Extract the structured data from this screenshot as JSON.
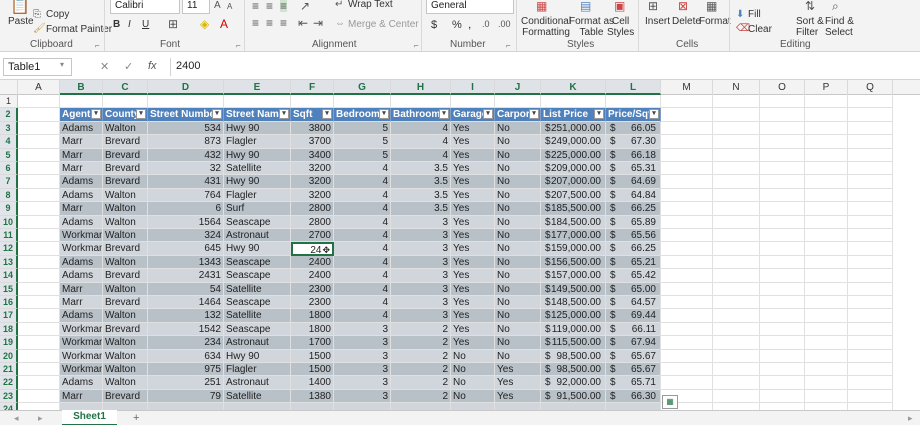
{
  "ribbon": {
    "paste": "Paste",
    "copy": "Copy",
    "format_painter": "Format Painter",
    "font_name": "Calibri",
    "font_size": "11",
    "bold": "B",
    "italic": "I",
    "underline": "U",
    "wrap_text": "Wrap Text",
    "merge_center": "Merge & Center",
    "number_format": "General",
    "currency": "$",
    "percent": "%",
    "comma": ",",
    "conditional_formatting": "Conditional\nFormatting",
    "format_as_table": "Format as\nTable",
    "cell_styles": "Cell\nStyles",
    "insert": "Insert",
    "delete": "Delete",
    "format": "Format",
    "fill": "Fill",
    "clear": "Clear",
    "sort_filter": "Sort &\nFilter",
    "find_select": "Find &\nSelect",
    "groups": {
      "clipboard": "Clipboard",
      "font": "Font",
      "alignment": "Alignment",
      "number": "Number",
      "styles": "Styles",
      "cells": "Cells",
      "editing": "Editing"
    }
  },
  "formula_bar": {
    "name_box": "Table1",
    "cancel": "✕",
    "enter": "✓",
    "fx": "fx",
    "value": "2400"
  },
  "sheet": {
    "columns": [
      "A",
      "B",
      "C",
      "D",
      "E",
      "F",
      "G",
      "H",
      "I",
      "J",
      "K",
      "L",
      "M",
      "N",
      "O",
      "P",
      "Q"
    ],
    "row_numbers": [
      "1",
      "2",
      "3",
      "4",
      "5",
      "6",
      "7",
      "8",
      "9",
      "10",
      "11",
      "12",
      "13",
      "14",
      "15",
      "16",
      "17",
      "18",
      "19",
      "20",
      "21",
      "22",
      "23",
      "24"
    ],
    "headers": [
      "Agent",
      "County",
      "Street Number",
      "Street Name",
      "Sqft",
      "Bedrooms",
      "Bathrooms",
      "Garage",
      "Carport",
      "List Price",
      "Price/Sqft"
    ],
    "rows": [
      [
        "Adams",
        "Walton",
        "534",
        "Hwy 90",
        "3800",
        "5",
        "4",
        "Yes",
        "No",
        "$",
        "251,000.00",
        "$",
        "66.05"
      ],
      [
        "Marr",
        "Brevard",
        "873",
        "Flagler",
        "3700",
        "5",
        "4",
        "Yes",
        "No",
        "$",
        "249,000.00",
        "$",
        "67.30"
      ],
      [
        "Marr",
        "Brevard",
        "432",
        "Hwy 90",
        "3400",
        "5",
        "4",
        "Yes",
        "No",
        "$",
        "225,000.00",
        "$",
        "66.18"
      ],
      [
        "Marr",
        "Brevard",
        "32",
        "Satellite",
        "3200",
        "4",
        "3.5",
        "Yes",
        "No",
        "$",
        "209,000.00",
        "$",
        "65.31"
      ],
      [
        "Adams",
        "Brevard",
        "431",
        "Hwy 90",
        "3200",
        "4",
        "3.5",
        "Yes",
        "No",
        "$",
        "207,000.00",
        "$",
        "64.69"
      ],
      [
        "Adams",
        "Walton",
        "764",
        "Flagler",
        "3200",
        "4",
        "3.5",
        "Yes",
        "No",
        "$",
        "207,500.00",
        "$",
        "64.84"
      ],
      [
        "Marr",
        "Walton",
        "6",
        "Surf",
        "2800",
        "4",
        "3.5",
        "Yes",
        "No",
        "$",
        "185,500.00",
        "$",
        "66.25"
      ],
      [
        "Adams",
        "Walton",
        "1564",
        "Seascape",
        "2800",
        "4",
        "3",
        "Yes",
        "No",
        "$",
        "184,500.00",
        "$",
        "65.89"
      ],
      [
        "Workman",
        "Walton",
        "324",
        "Astronaut",
        "2700",
        "4",
        "3",
        "Yes",
        "No",
        "$",
        "177,000.00",
        "$",
        "65.56"
      ],
      [
        "Workman",
        "Brevard",
        "645",
        "Hwy 90",
        "2400",
        "4",
        "3",
        "Yes",
        "No",
        "$",
        "159,000.00",
        "$",
        "66.25"
      ],
      [
        "Adams",
        "Walton",
        "1343",
        "Seascape",
        "2400",
        "4",
        "3",
        "Yes",
        "No",
        "$",
        "156,500.00",
        "$",
        "65.21"
      ],
      [
        "Adams",
        "Brevard",
        "2431",
        "Seascape",
        "2400",
        "4",
        "3",
        "Yes",
        "No",
        "$",
        "157,000.00",
        "$",
        "65.42"
      ],
      [
        "Marr",
        "Walton",
        "54",
        "Satellite",
        "2300",
        "4",
        "3",
        "Yes",
        "No",
        "$",
        "149,500.00",
        "$",
        "65.00"
      ],
      [
        "Marr",
        "Brevard",
        "1464",
        "Seascape",
        "2300",
        "4",
        "3",
        "Yes",
        "No",
        "$",
        "148,500.00",
        "$",
        "64.57"
      ],
      [
        "Adams",
        "Walton",
        "132",
        "Satellite",
        "1800",
        "4",
        "3",
        "Yes",
        "No",
        "$",
        "125,000.00",
        "$",
        "69.44"
      ],
      [
        "Workman",
        "Brevard",
        "1542",
        "Seascape",
        "1800",
        "3",
        "2",
        "Yes",
        "No",
        "$",
        "119,000.00",
        "$",
        "66.11"
      ],
      [
        "Workman",
        "Walton",
        "234",
        "Astronaut",
        "1700",
        "3",
        "2",
        "Yes",
        "No",
        "$",
        "115,500.00",
        "$",
        "67.94"
      ],
      [
        "Workman",
        "Walton",
        "634",
        "Hwy 90",
        "1500",
        "3",
        "2",
        "No",
        "No",
        "$",
        "98,500.00",
        "$",
        "65.67"
      ],
      [
        "Workman",
        "Walton",
        "975",
        "Flagler",
        "1500",
        "3",
        "2",
        "No",
        "Yes",
        "$",
        "98,500.00",
        "$",
        "65.67"
      ],
      [
        "Adams",
        "Walton",
        "251",
        "Astronaut",
        "1400",
        "3",
        "2",
        "No",
        "Yes",
        "$",
        "92,000.00",
        "$",
        "65.71"
      ],
      [
        "Marr",
        "Brevard",
        "79",
        "Satellite",
        "1380",
        "3",
        "2",
        "No",
        "Yes",
        "$",
        "91,500.00",
        "$",
        "66.30"
      ]
    ],
    "active_cell_text": "24"
  },
  "tabs": {
    "sheet1": "Sheet1",
    "add": "+"
  }
}
